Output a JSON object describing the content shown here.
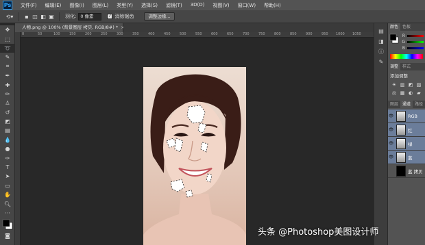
{
  "menubar": {
    "logo": "Ps",
    "items": [
      "文件(F)",
      "编辑(E)",
      "图像(I)",
      "图层(L)",
      "类型(Y)",
      "选择(S)",
      "滤镜(T)",
      "3D(D)",
      "视图(V)",
      "窗口(W)",
      "帮助(H)"
    ]
  },
  "options": {
    "feather_label": "羽化:",
    "feather_value": "0 像素",
    "antialias_label": "消除锯齿",
    "refine_edge_label": "调整边缘..."
  },
  "document": {
    "tab_title": "人物.png @ 100% (背景图层 拷贝, RGB/8#) *",
    "close_glyph": "×",
    "ruler_ticks": [
      "0",
      "50",
      "100",
      "150",
      "200",
      "250",
      "300",
      "350",
      "400",
      "450",
      "500",
      "550",
      "600",
      "650",
      "700",
      "750",
      "800",
      "850",
      "900",
      "950",
      "1000",
      "1050"
    ]
  },
  "panels": {
    "color_tabs": [
      "颜色",
      "色板"
    ],
    "color_channels": [
      "R",
      "G",
      "B"
    ],
    "adjust_tabs": [
      "调整",
      "样式"
    ],
    "adjust_title": "添加调整",
    "layer_tabs": [
      "图层",
      "通道",
      "路径"
    ],
    "channels": [
      {
        "label": "RGB",
        "active": true
      },
      {
        "label": "红",
        "active": true
      },
      {
        "label": "绿",
        "active": true
      },
      {
        "label": "蓝",
        "active": true
      },
      {
        "label": "蓝 拷贝",
        "active": false
      }
    ]
  },
  "watermark": "头条 @Photoshop美图设计师",
  "colors": {
    "menubar": "#535353",
    "workspace": "#282828",
    "channel_selected": "#6b7d9a"
  }
}
